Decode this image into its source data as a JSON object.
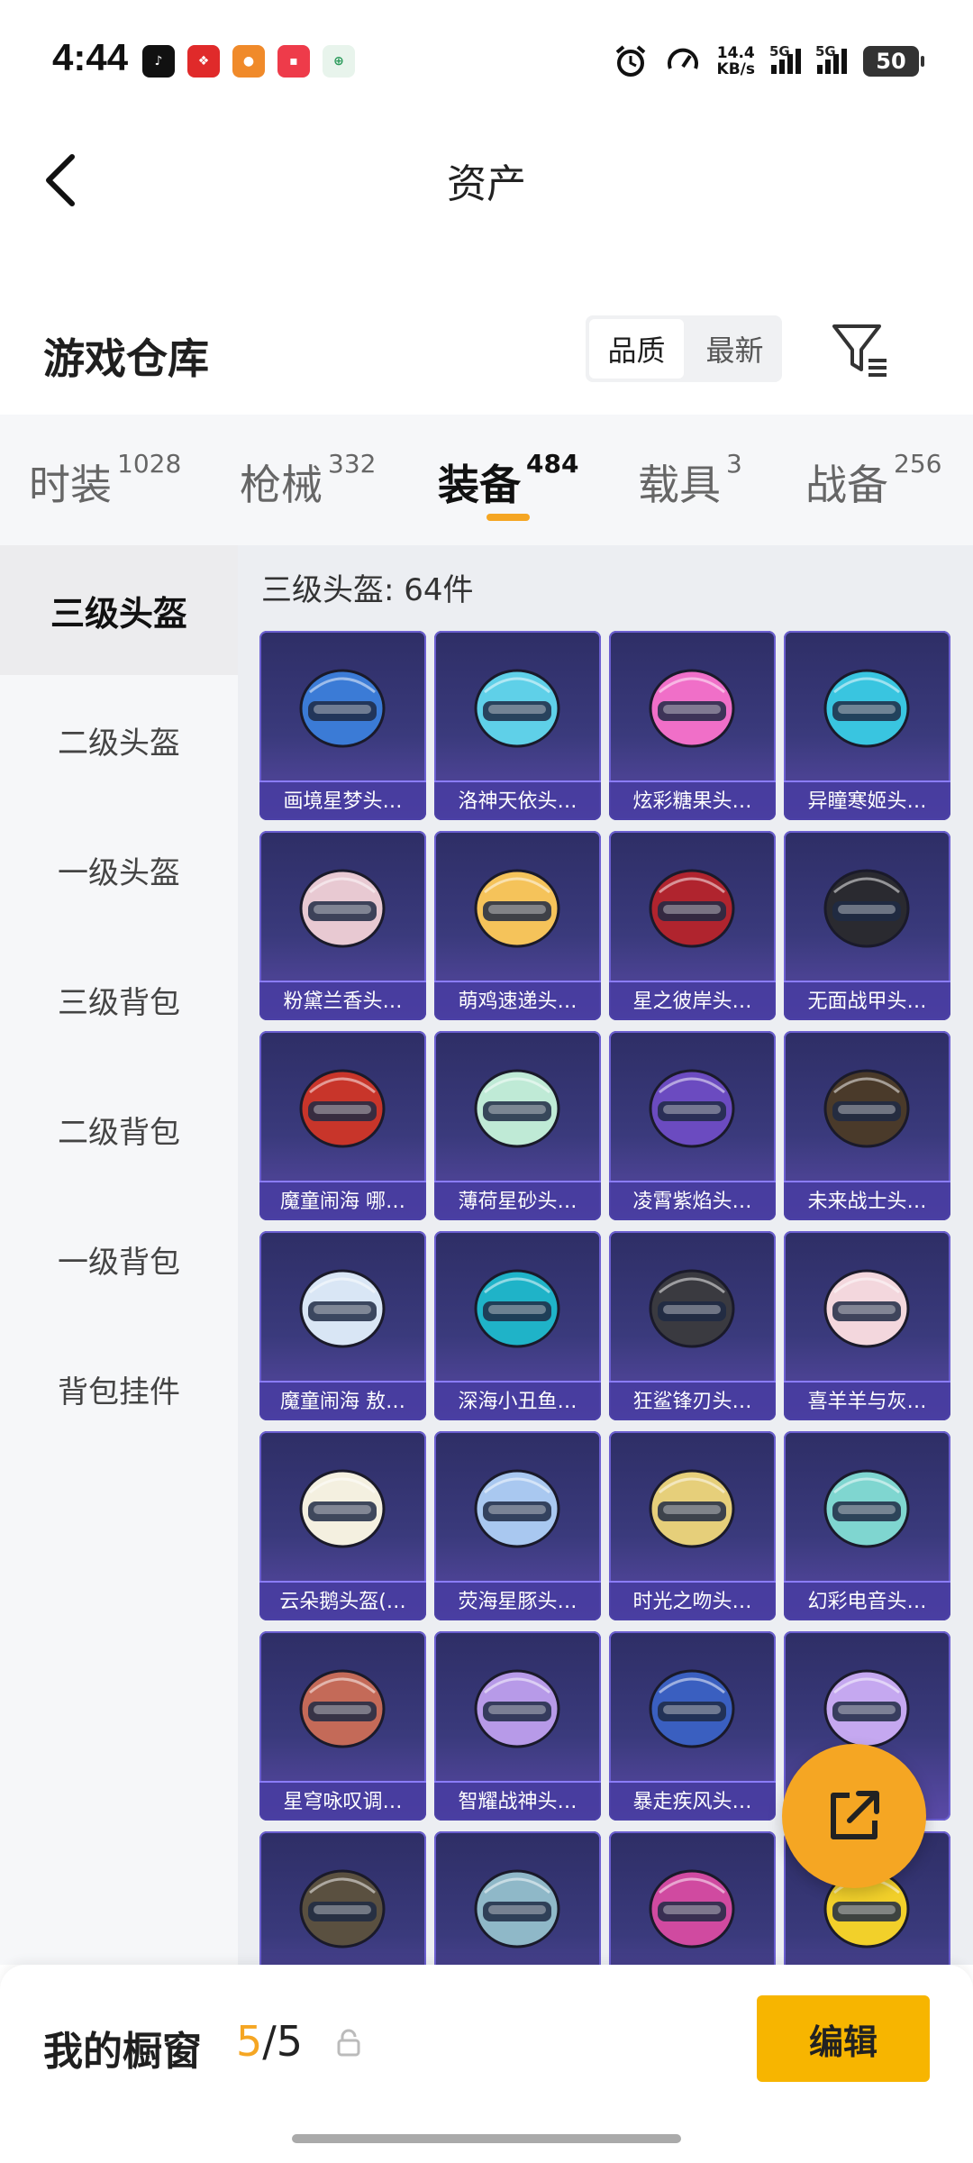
{
  "status_bar": {
    "time": "4:44",
    "net_speed_value": "14.4",
    "net_speed_unit": "KB/s",
    "signal1_label": "5G",
    "signal2_label": "5G",
    "battery": "50",
    "app_icons": [
      "tiktok-icon",
      "red-app-icon",
      "orange-app-icon",
      "xiaohongshu-icon",
      "green-app-icon"
    ]
  },
  "header": {
    "title": "资产"
  },
  "section": {
    "title": "游戏仓库",
    "sort_quality": "品质",
    "sort_newest": "最新"
  },
  "tabs": [
    {
      "label": "时装",
      "count": "1028"
    },
    {
      "label": "枪械",
      "count": "332"
    },
    {
      "label": "装备",
      "count": "484"
    },
    {
      "label": "载具",
      "count": "3"
    },
    {
      "label": "战备",
      "count": "256"
    }
  ],
  "active_tab": 2,
  "left_nav": [
    {
      "label": "三级头盔"
    },
    {
      "label": "二级头盔"
    },
    {
      "label": "一级头盔"
    },
    {
      "label": "三级背包"
    },
    {
      "label": "二级背包"
    },
    {
      "label": "一级背包"
    },
    {
      "label": "背包挂件"
    }
  ],
  "grid": {
    "count_label": "三级头盔: 64件",
    "items": [
      {
        "name": "画境星梦头…",
        "color": "#3b7bd6"
      },
      {
        "name": "洛神天依头…",
        "color": "#5fd0e8"
      },
      {
        "name": "炫彩糖果头…",
        "color": "#f06fc8"
      },
      {
        "name": "异瞳寒姬头…",
        "color": "#39c5e0"
      },
      {
        "name": "粉黛兰香头…",
        "color": "#e8c9d2"
      },
      {
        "name": "萌鸡速递头…",
        "color": "#f5c35a"
      },
      {
        "name": "星之彼岸头…",
        "color": "#b0242e"
      },
      {
        "name": "无面战甲头…",
        "color": "#2a2a30"
      },
      {
        "name": "魔童闹海 哪…",
        "color": "#c8352a"
      },
      {
        "name": "薄荷星砂头…",
        "color": "#bfead6"
      },
      {
        "name": "凌霄紫焰头…",
        "color": "#6b4bc0"
      },
      {
        "name": "未来战士头…",
        "color": "#4a3a2a"
      },
      {
        "name": "魔童闹海 敖…",
        "color": "#d9e6f5"
      },
      {
        "name": "深海小丑鱼…",
        "color": "#1fb3c8"
      },
      {
        "name": "狂鲨锋刃头…",
        "color": "#3a3a40"
      },
      {
        "name": "喜羊羊与灰…",
        "color": "#f3d7dd"
      },
      {
        "name": "云朵鹅头盔(…",
        "color": "#f4f0e0"
      },
      {
        "name": "荧海星豚头…",
        "color": "#a9c8f0"
      },
      {
        "name": "时光之吻头…",
        "color": "#e6cf7a"
      },
      {
        "name": "幻彩电音头…",
        "color": "#7fd6d0"
      },
      {
        "name": "星穹咏叹调…",
        "color": "#c46a58"
      },
      {
        "name": "智耀战神头…",
        "color": "#b79ae8"
      },
      {
        "name": "暴走疾风头…",
        "color": "#3a5fc0"
      },
      {
        "name": "",
        "color": "#c5a8f0"
      },
      {
        "name": "",
        "color": "#5a5040"
      },
      {
        "name": "",
        "color": "#8fb8c8"
      },
      {
        "name": "",
        "color": "#d04aa0"
      },
      {
        "name": "",
        "color": "#f2d02a"
      }
    ]
  },
  "bottom": {
    "showcase_label": "我的橱窗",
    "showcase_current": "5",
    "showcase_sep": "/",
    "showcase_total": "5",
    "edit_label": "编辑"
  },
  "colors": {
    "accent": "#f5a623",
    "card_bg": "#3a3a7c"
  }
}
